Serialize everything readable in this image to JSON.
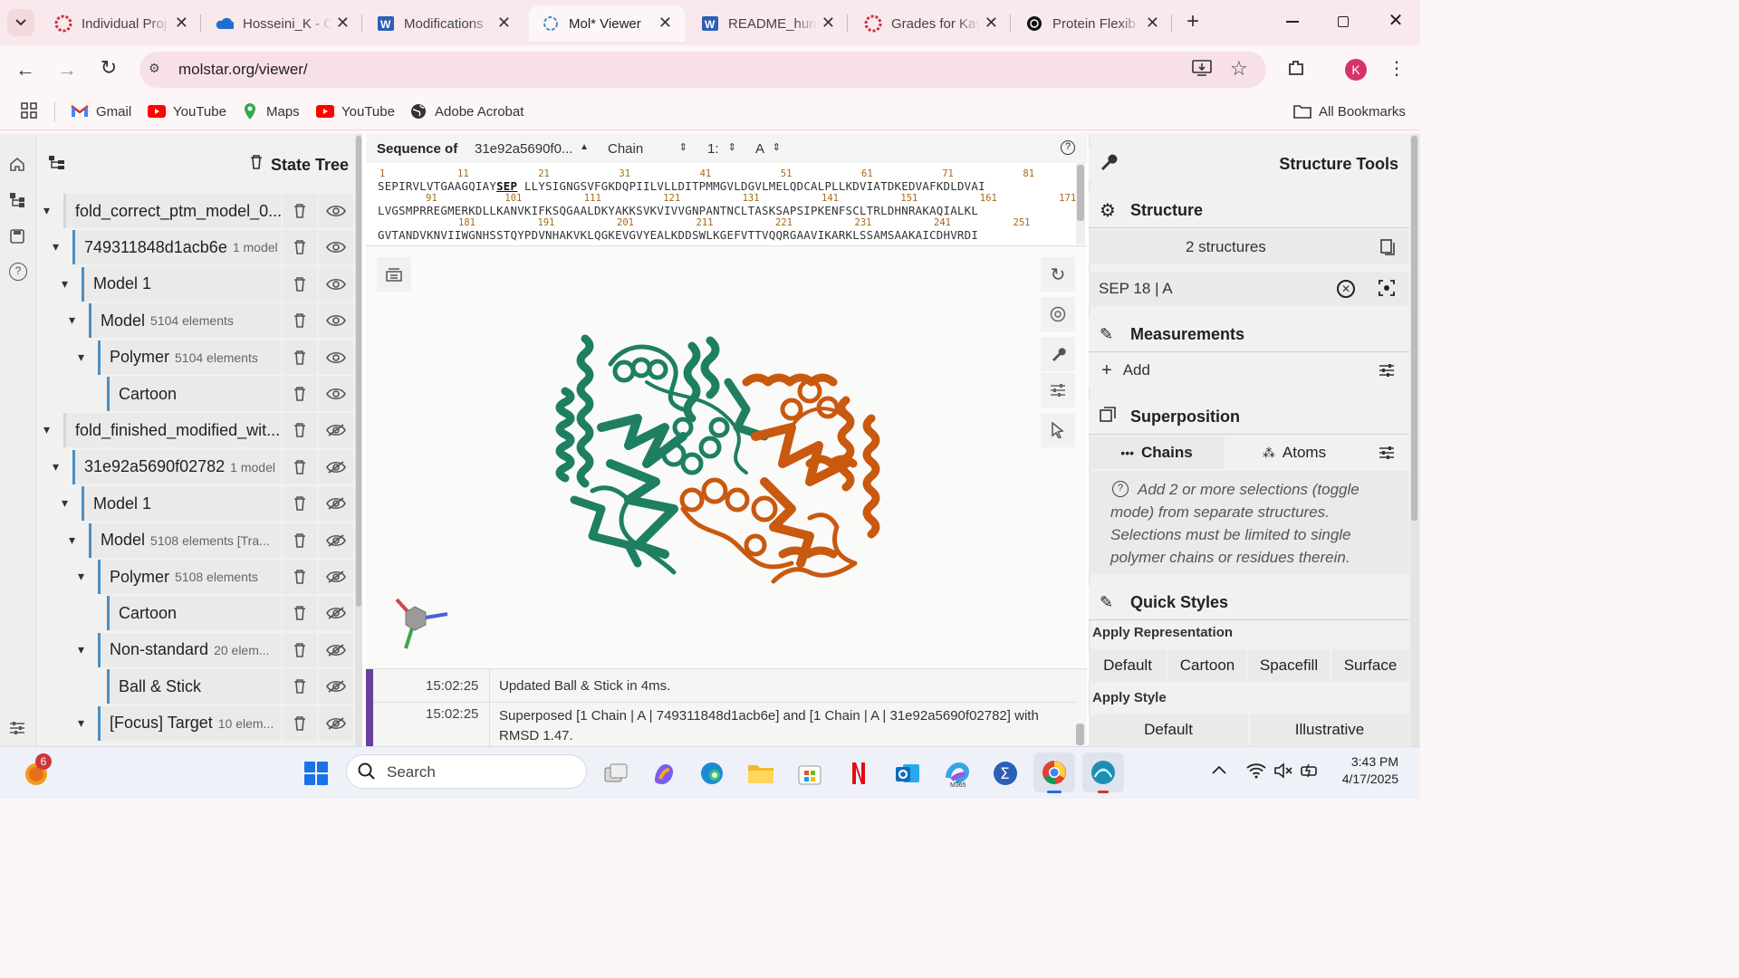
{
  "browser": {
    "tabs": [
      {
        "label": "Individual Proj",
        "icon": "asu-icon",
        "active": false
      },
      {
        "label": "Hosseini_K - C",
        "icon": "onedrive-icon",
        "active": false
      },
      {
        "label": "Modifications",
        "icon": "word-icon",
        "active": false
      },
      {
        "label": "Mol* Viewer",
        "icon": "molstar-icon",
        "active": true
      },
      {
        "label": "README_hum",
        "icon": "word-icon",
        "active": false
      },
      {
        "label": "Grades for Kay",
        "icon": "asu-icon",
        "active": false
      },
      {
        "label": "Protein Flexib",
        "icon": "chatgpt-icon",
        "active": false
      }
    ],
    "url": "molstar.org/viewer/",
    "profile_initial": "K",
    "bookmarks": [
      "Gmail",
      "YouTube",
      "Maps",
      "YouTube",
      "Adobe Acrobat"
    ],
    "all_bookmarks": "All Bookmarks"
  },
  "state_tree": {
    "title": "State Tree",
    "rows": [
      {
        "label": "fold_correct_ptm_model_0...",
        "sub": ""
      },
      {
        "label": "749311848d1acb6e",
        "sub": "1 model"
      },
      {
        "label": "Model 1",
        "sub": ""
      },
      {
        "label": "Model",
        "sub": "5104 elements"
      },
      {
        "label": "Polymer",
        "sub": "5104 elements"
      },
      {
        "label": "Cartoon",
        "sub": ""
      },
      {
        "label": "fold_finished_modified_wit...",
        "sub": ""
      },
      {
        "label": "31e92a5690f02782",
        "sub": "1 model"
      },
      {
        "label": "Model 1",
        "sub": ""
      },
      {
        "label": "Model",
        "sub": "5108 elements [Tra..."
      },
      {
        "label": "Polymer",
        "sub": "5108 elements"
      },
      {
        "label": "Cartoon",
        "sub": ""
      },
      {
        "label": "Non-standard",
        "sub": "20 elem..."
      },
      {
        "label": "Ball & Stick",
        "sub": ""
      },
      {
        "label": "[Focus] Target",
        "sub": "10 elem..."
      }
    ]
  },
  "sequence": {
    "label": "Sequence of",
    "entity": "31e92a5690f0...",
    "mode": "Chain",
    "model": "1:",
    "chain": "A",
    "line1_pre": "SEPIRVLVTGAAGQIAY",
    "line1_highlight": "SEP",
    "line1_post": "LLYSIGNGSVFGKDQPIILVLLDITPMMGVLDGVLMELQDCALPLLKDVIATDKEDVAFKDLDVAI",
    "line2": "LVGSMPRREGMERKDLLKANVKIFKSQGAALDKYAKKSVKVIVVGNPANTNCLTASKSAPSIPKENFSCLTRLDHNRAKAQIALKL",
    "line3": "GVTANDVKNVIIWGNHSSTQYPDVNHAKVKLQGKEVGVYEALKDDSWLKGEFVTTVQQRGAAVIKARKLSSAMSAAKAICDHVRDI",
    "nums1": [
      "1",
      "11",
      "21",
      "31",
      "41",
      "51",
      "61",
      "71",
      "81"
    ],
    "nums2": [
      "91",
      "101",
      "111",
      "121",
      "131",
      "141",
      "151",
      "161",
      "171"
    ],
    "nums3": [
      "181",
      "191",
      "201",
      "211",
      "221",
      "231",
      "241",
      "251"
    ]
  },
  "log": [
    {
      "time": "15:02:25",
      "msg": "Updated Ball & Stick in 4ms."
    },
    {
      "time": "15:02:25",
      "msg": "Superposed [1 Chain | A | 749311848d1acb6e] and [1 Chain | A | 31e92a5690f02782] with RMSD 1.47."
    }
  ],
  "structure_tools": {
    "title": "Structure Tools",
    "structure_label": "Structure",
    "structures_count": "2 structures",
    "selection": "SEP 18 | A",
    "measurements_label": "Measurements",
    "add_label": "Add",
    "superposition_label": "Superposition",
    "chains_tab": "Chains",
    "atoms_tab": "Atoms",
    "hint": "Add 2 or more selections (toggle mode) from separate structures. Selections must be limited to single polymer chains or residues therein.",
    "quick_styles_label": "Quick Styles",
    "apply_representation": "Apply Representation",
    "rep_buttons": [
      "Default",
      "Cartoon",
      "Spacefill",
      "Surface"
    ],
    "apply_style": "Apply Style",
    "style_buttons": [
      "Default",
      "Illustrative"
    ]
  },
  "taskbar": {
    "search_placeholder": "Search",
    "notification_count": "6",
    "time": "3:43 PM",
    "date": "4/17/2025"
  },
  "colors": {
    "chain_green": "#1e7f62",
    "chain_orange": "#c9590f",
    "accent": "#6b3fa0"
  }
}
